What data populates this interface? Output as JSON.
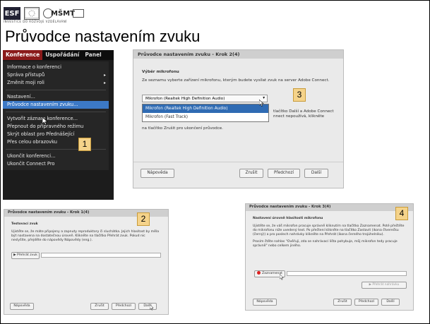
{
  "slide": {
    "title": "Průvodce nastavením zvuku",
    "logos": {
      "esf": "ESF",
      "msmt": "MŠMT",
      "caption": "INVESTICE DO ROZVOJE VZDĚLÁVÁNÍ"
    }
  },
  "menu_shot": {
    "menubar": [
      "Konference",
      "Uspořádání",
      "Panel"
    ],
    "items": [
      "Informace o konferenci",
      "Správa přístupů",
      "Změnit moji roli",
      "Nastavení...",
      "Průvodce nastavením zvuku...",
      "Vytvořit záznam konference...",
      "Přepnout do přípravného režimu",
      "Skrýt oblast pro Přednášející",
      "Přes celou obrazovku",
      "Ukončit konferenci...",
      "Ukončit Connect Pro"
    ],
    "arrow": "▸"
  },
  "step2": {
    "title": "Průvodce nastavením zvuku - Krok 2(4)",
    "section": "Výběr mikrofonu",
    "intro": "Ze seznamu vyberte zařízení mikrofonu, kterým budete vysílat zvuk na server Adobe Connect.",
    "select_value": "Mikrofon (Realtek High Definition Audio)",
    "options": [
      "Mikrofon (Realtek High Definition Audio)",
      "Mikrofon (Fast Track)"
    ],
    "right_text": "tlačítko Další a Adobe Connect nnect nepoužívá, klikněte",
    "left_text": "na tlačítko Zrušit pro ukončení průvodce.",
    "buttons": {
      "help": "Nápověda",
      "cancel": "Zrušit",
      "back": "Předchozí",
      "next": "Další"
    }
  },
  "step1": {
    "title": "Průvodce nastavením zvuku - Krok 1(4)",
    "section": "Testovací zvuk",
    "body": "Ujistěte se, že máte připojeny a zapnuty reproduktory či sluchátka. Jejich hlasitost by měla být nastavena na dostatečnou úroveň. Klikněte na tlačítko Přehrát zvuk. Pokud nic neslyšíte, přejděte do nápovědy Nápovědy (eng.).",
    "play_button": "▶ Přehrát zvuk",
    "buttons": {
      "help": "Nápověda",
      "cancel": "Zrušit",
      "back": "Předchozí",
      "next": "Další"
    }
  },
  "step3": {
    "title": "Průvodce nastavením zvuku - Krok 3(4)",
    "section": "Nastavení úrovně hlasitosti mikrofonu",
    "body": "Ujistěte se, že váš mikrofon pracuje správně kliknutím na tlačítko Zaznamenat. Poté přečtěte do mikrofonu níže uvedený text. Po přečtení klikněte na tlačítko Zastavit (ikona čtverečku (černý)) a pro poslech nahrávky klikněte na Přehrát (ikona černého trojúhelníku).",
    "quote": "Prosím čtěte nahlas \"Ověřuji, zda se nahrávací lišta pohybuje, můj mikrofon tedy pracuje správně\" nebo celkem jiného.",
    "record_button": "Zaznamenat",
    "play_button": "▶ Přehrát nahrávku",
    "buttons": {
      "help": "Nápověda",
      "cancel": "Zrušit",
      "back": "Předchozí",
      "next": "Další"
    }
  },
  "badges": [
    "1",
    "2",
    "3",
    "4"
  ]
}
